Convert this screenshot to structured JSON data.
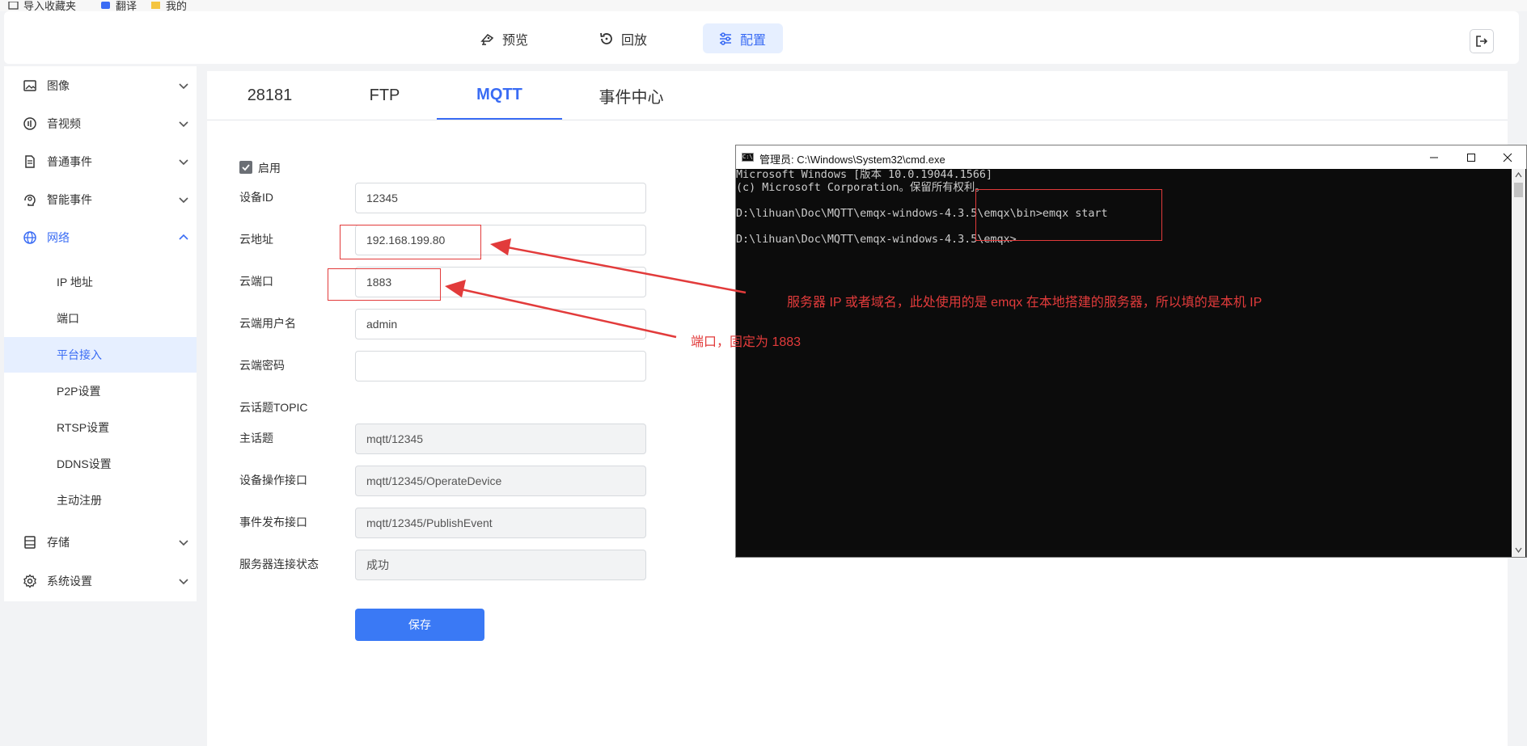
{
  "bookmarks": [
    {
      "label": "导入收藏夹",
      "icon": "import-icon"
    },
    {
      "label": "翻译",
      "icon": "translate-icon"
    },
    {
      "label": "我的",
      "icon": "folder-icon"
    }
  ],
  "topnav": {
    "preview": "预览",
    "playback": "回放",
    "config": "配置"
  },
  "sidebar": {
    "items": [
      {
        "label": "图像",
        "icon": "image-icon"
      },
      {
        "label": "音视频",
        "icon": "audio-video-icon"
      },
      {
        "label": "普通事件",
        "icon": "document-icon"
      },
      {
        "label": "智能事件",
        "icon": "brain-icon"
      },
      {
        "label": "网络",
        "icon": "globe-icon"
      },
      {
        "label": "存储",
        "icon": "storage-icon"
      },
      {
        "label": "系统设置",
        "icon": "gear-icon"
      }
    ],
    "network_sub": [
      "IP 地址",
      "端口",
      "平台接入",
      "P2P设置",
      "RTSP设置",
      "DDNS设置",
      "主动注册"
    ]
  },
  "tabs": [
    "28181",
    "FTP",
    "MQTT",
    "事件中心"
  ],
  "form": {
    "enable_label": "启用",
    "device_id_label": "设备ID",
    "device_id": "12345",
    "cloud_addr_label": "云地址",
    "cloud_addr": "192.168.199.80",
    "cloud_port_label": "云端口",
    "cloud_port": "1883",
    "username_label": "云端用户名",
    "username": "admin",
    "password_label": "云端密码",
    "password": "",
    "topic_label": "云话题TOPIC",
    "main_topic_label": "主话题",
    "main_topic": "mqtt/12345",
    "operate_label": "设备操作接口",
    "operate": "mqtt/12345/OperateDevice",
    "publish_label": "事件发布接口",
    "publish": "mqtt/12345/PublishEvent",
    "status_label": "服务器连接状态",
    "status": "成功",
    "save": "保存"
  },
  "cmd": {
    "title": "管理员: C:\\Windows\\System32\\cmd.exe",
    "lines": [
      "Microsoft Windows [版本 10.0.19044.1566]",
      "(c) Microsoft Corporation。保留所有权利。",
      "",
      "D:\\lihuan\\Doc\\MQTT\\emqx-windows-4.3.5\\emqx\\bin>emqx start",
      "",
      "D:\\lihuan\\Doc\\MQTT\\emqx-windows-4.3.5\\emqx>"
    ]
  },
  "annotations": {
    "server_note": "服务器 IP 或者域名，此处使用的是 emqx 在本地搭建的服务器，所以填的是本机 IP",
    "port_note": "端口，固定为 1883"
  },
  "colors": {
    "accent": "#3a6cf4",
    "annotation": "#e23b3b",
    "active_bg": "#e6efff"
  }
}
